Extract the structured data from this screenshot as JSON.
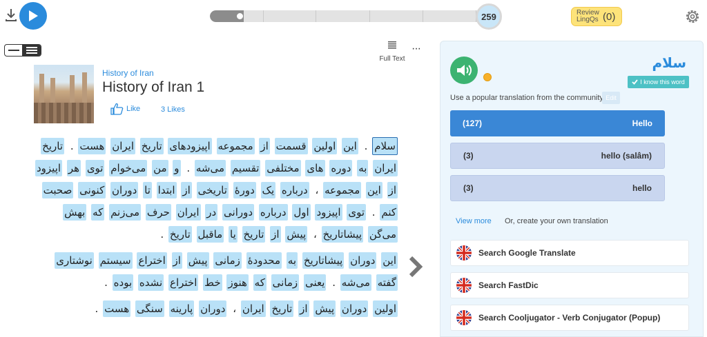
{
  "player": {
    "progress": 0.12
  },
  "header": {
    "known_count": "259",
    "review_label": "Review LingQs",
    "review_count": "(0)"
  },
  "toolbar": {
    "full_text_label": "Full Text",
    "more_label": "···"
  },
  "lesson": {
    "course": "History of Iran",
    "title": "History of Iran 1",
    "like_label": "Like",
    "likes_count": "3 Likes"
  },
  "text": {
    "paragraphs": [
      {
        "words": [
          "سلام",
          ".",
          "این",
          "اولین",
          "قسمت",
          "از",
          "مجموعه",
          "اپیزودهای",
          "تاریخ",
          "ایران",
          "هست",
          ".",
          "تاریخ",
          "ایران",
          "به",
          "دوره",
          "های",
          "مختلفی",
          "تقسیم",
          "می‌شه",
          ".",
          "و",
          "من",
          "می‌خوام",
          "توی",
          "هر",
          "اپیزود",
          "از",
          "این",
          "مجموعه",
          "،",
          "درباره",
          "یک",
          "دورهٔ",
          "تاریخی",
          "از",
          "ابتدا",
          "تا",
          "دوران",
          "کنونی",
          "صحبت",
          "کنم",
          ".",
          "توی",
          "اپیزود",
          "اول",
          "درباره",
          "دورانی",
          "در",
          "ایران",
          "حرف",
          "می‌زنم",
          "که",
          "بهش",
          "می‌گن",
          "پیشاتاریخ",
          "،",
          "پیش",
          "از",
          "تاریخ",
          "یا",
          "ماقبل",
          "تاریخ",
          "."
        ]
      },
      {
        "words": [
          "این",
          "دوران",
          "پیشاتاریخ",
          "به",
          "محدودهٔ",
          "زمانی",
          "پیش",
          "از",
          "اختراع",
          "سیستم",
          "نوشتاری",
          "گفته",
          "می‌شه",
          ".",
          "یعنی",
          "زمانی",
          "که",
          "هنوز",
          "خط",
          "اختراع",
          "نشده",
          "بوده",
          "."
        ]
      },
      {
        "words": [
          "اولین",
          "دوران",
          "پیش",
          "از",
          "تاریخ",
          "ایران",
          "،",
          "دوران",
          "پارینه",
          "سنگی",
          "هست",
          "."
        ]
      }
    ]
  },
  "panel": {
    "term": "سلام",
    "know_label": "I know this word",
    "hint": "Use a popular translation from the community",
    "edit_label": "Edit",
    "translations": [
      {
        "count": "(127)",
        "text": "Hello"
      },
      {
        "count": "(3)",
        "text": "hello (salâm)"
      },
      {
        "count": "(3)",
        "text": "hello"
      }
    ],
    "view_more": "View more",
    "create_own": "Or, create your own translation",
    "searches": [
      {
        "label": "Search Google Translate"
      },
      {
        "label": "Search FastDic"
      },
      {
        "label": "Search Cooljugator - Verb Conjugator (Popup)"
      }
    ]
  },
  "colors": {
    "accent": "#2a8bdc",
    "word_highlight": "#b9e1f7",
    "review": "#fde37a",
    "sound": "#3cb371",
    "know": "#4dc1c5"
  },
  "icons": [
    "download-icon",
    "play-icon",
    "gear-icon",
    "view-toggle-icon",
    "full-text-icon",
    "more-icon",
    "thumbs-up-icon",
    "chevron-right-icon",
    "speaker-icon",
    "coin-icon",
    "check-icon",
    "uk-flag-icon"
  ]
}
